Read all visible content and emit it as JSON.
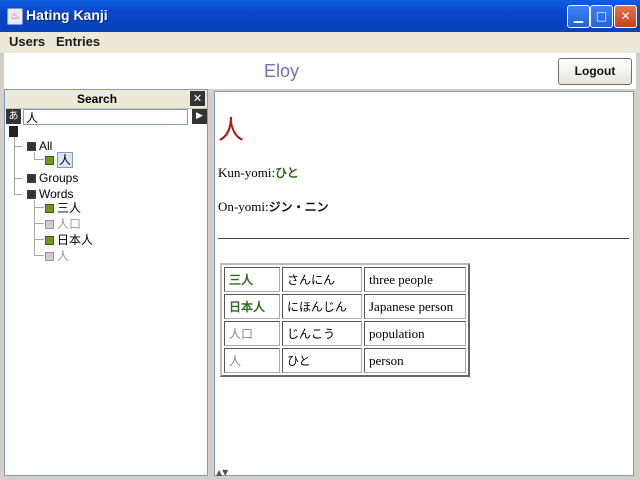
{
  "window": {
    "title": "Hating Kanji",
    "minimize_icon": "minimize-icon",
    "maximize_icon": "maximize-icon",
    "close_icon": "close-icon"
  },
  "menu": {
    "items": [
      "Users",
      "Entries"
    ]
  },
  "user": {
    "name": "Eloy",
    "logout_label": "Logout"
  },
  "search": {
    "label": "Search",
    "ime_label": "あ",
    "query": "人"
  },
  "tree": {
    "root": "All",
    "root_child": "人",
    "groups": "Groups",
    "words": "Words",
    "word_items": [
      {
        "label": "三人",
        "state": "green"
      },
      {
        "label": "人口",
        "state": "grey"
      },
      {
        "label": "日本人",
        "state": "green"
      },
      {
        "label": "人",
        "state": "grey"
      }
    ]
  },
  "detail": {
    "kanji": "人",
    "kun_label": "Kun-yomi:",
    "kun_value": "ひと",
    "on_label": "On-yomi:",
    "on_value": "ジン・ニン",
    "words": [
      {
        "kanji": "三人",
        "reading": "さんにん",
        "meaning": "three people",
        "state": "green"
      },
      {
        "kanji": "日本人",
        "reading": "にほんじん",
        "meaning": "Japanese person",
        "state": "green"
      },
      {
        "kanji": "人口",
        "reading": "じんこう",
        "meaning": "population",
        "state": "grey"
      },
      {
        "kanji": "人",
        "reading": "ひと",
        "meaning": "person",
        "state": "grey"
      }
    ]
  },
  "colors": {
    "accent_green": "#2d6b1e",
    "kanji_red": "#b0141b",
    "titlebar_blue": "#0a46c9"
  }
}
